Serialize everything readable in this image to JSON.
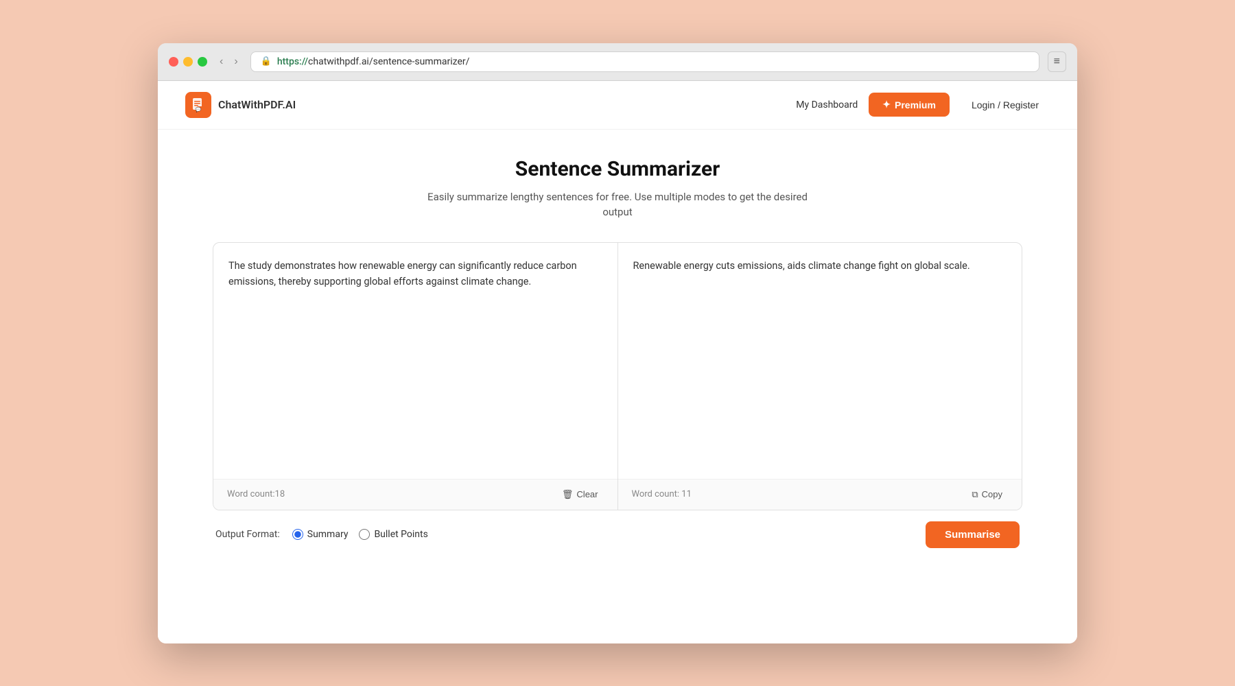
{
  "browser": {
    "url_protocol": "https://",
    "url_rest": "chatwithpdf.ai/sentence-summarizer/",
    "back_label": "‹",
    "forward_label": "›",
    "menu_label": "≡"
  },
  "header": {
    "logo_text": "ChatWithPDF.AI",
    "nav_dashboard": "My Dashboard",
    "nav_premium": "Premium",
    "nav_login": "Login / Register"
  },
  "main": {
    "title": "Sentence Summarizer",
    "subtitle_line1": "Easily summarize lengthy sentences for free. Use multiple modes to get the desired",
    "subtitle_line2": "output",
    "input_text": "The study demonstrates how renewable energy can significantly reduce carbon emissions, thereby supporting global efforts against climate change.",
    "output_text": "Renewable energy cuts emissions, aids climate change fight on global scale.",
    "word_count_input": "Word count:18",
    "word_count_output": "Word count: 11",
    "clear_label": "Clear",
    "copy_label": "Copy",
    "output_format_label": "Output Format:",
    "format_summary": "Summary",
    "format_bullet": "Bullet Points",
    "summarise_btn": "Summarise"
  },
  "icons": {
    "lock": "🔒",
    "premium_star": "✦",
    "clear_icon": "🗑",
    "copy_icon": "⧉",
    "logo": "📄"
  }
}
